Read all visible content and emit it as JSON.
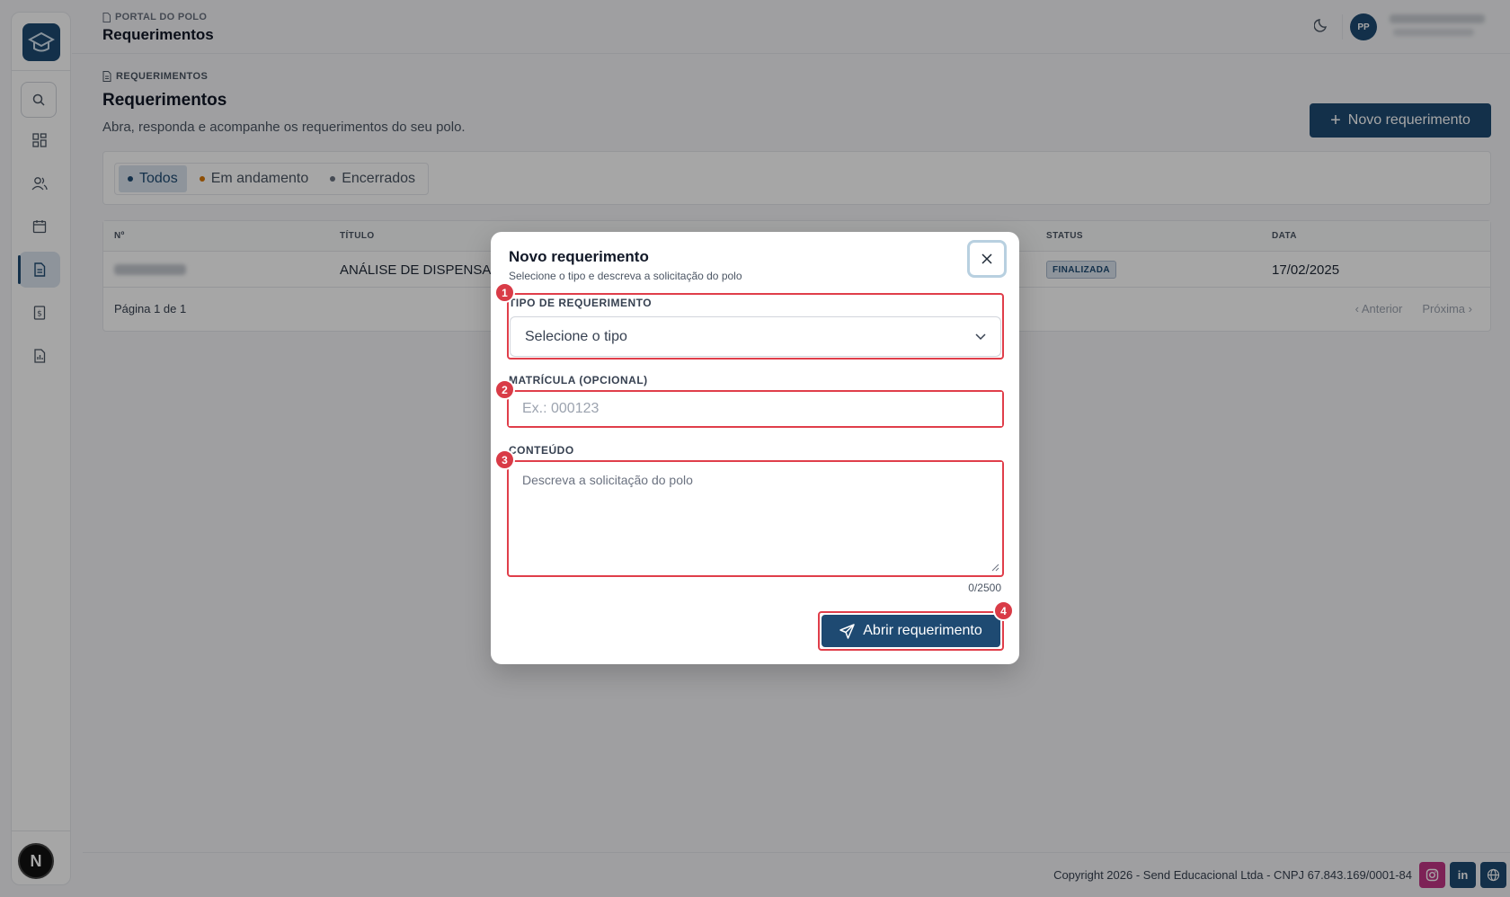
{
  "topbar": {
    "breadcrumb": "PORTAL DO POLO",
    "title": "Requerimentos",
    "user_initials": "PP"
  },
  "page": {
    "breadcrumb": "REQUERIMENTOS",
    "title": "Requerimentos",
    "subtitle": "Abra, responda e acompanhe os requerimentos do seu polo.",
    "new_button": "Novo requerimento"
  },
  "filters": [
    {
      "label": "Todos",
      "dot": "#1e4a72"
    },
    {
      "label": "Em andamento",
      "dot": "#d97706"
    },
    {
      "label": "Encerrados",
      "dot": "#6b7280"
    }
  ],
  "table": {
    "columns": [
      "Nº",
      "TÍTULO",
      "STATUS",
      "DATA"
    ],
    "rows": [
      {
        "title": "ANÁLISE DE DISPENSA -",
        "status": "FINALIZADA",
        "date": "17/02/2025"
      }
    ],
    "page_info": "Página 1 de 1",
    "prev": "Anterior",
    "next": "Próxima"
  },
  "footer": {
    "copyright": "Copyright 2026 - Send Educacional Ltda - CNPJ 67.843.169/0001-84",
    "social": [
      "instagram-icon",
      "linkedin-icon",
      "globe-icon"
    ],
    "linkedin_text": "in"
  },
  "sidebar": {
    "avatar_letter": "N",
    "items": [
      "search-icon",
      "dashboard-icon",
      "users-icon",
      "calendar-icon",
      "document-icon",
      "finance-icon",
      "report-icon"
    ]
  },
  "modal": {
    "title": "Novo requerimento",
    "subtitle": "Selecione o tipo e descreva a solicitação do polo",
    "type_label": "TIPO DE REQUERIMENTO",
    "type_placeholder": "Selecione o tipo",
    "enrollment_label": "MATRÍCULA (OPCIONAL)",
    "enrollment_placeholder": "Ex.: 000123",
    "content_label": "CONTEÚDO",
    "content_placeholder": "Descreva a solicitação do polo",
    "counter": "0/2500",
    "submit": "Abrir requerimento",
    "markers": [
      "1",
      "2",
      "3",
      "4"
    ]
  },
  "colors": {
    "brand": "#1e4a72",
    "highlight": "#e03e4a"
  }
}
